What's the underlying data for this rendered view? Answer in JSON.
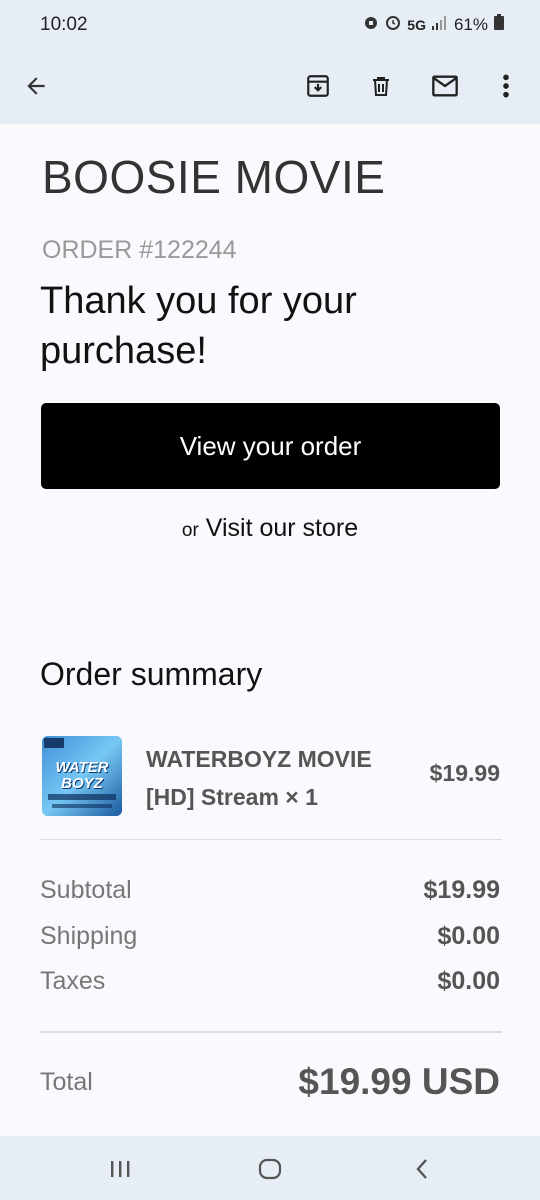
{
  "status_bar": {
    "time": "10:02",
    "network": "5G",
    "battery": "61%"
  },
  "app_bar": {
    "icons": [
      "back-arrow-icon",
      "archive-icon",
      "delete-icon",
      "mail-icon",
      "more-vert-icon"
    ]
  },
  "email": {
    "brand": "BOOSIE MOVIE",
    "order_number": "ORDER #122244",
    "thank_you": "Thank you for your purchase!",
    "view_order_button": "View your order",
    "or_text": "or",
    "visit_store_link": "Visit our store"
  },
  "order_summary": {
    "title": "Order summary",
    "item": {
      "name": "WATERBOYZ MOVIE [HD] Stream × 1",
      "price": "$19.99",
      "thumb_title": "WATER BOYZ"
    },
    "subtotal_label": "Subtotal",
    "subtotal_value": "$19.99",
    "shipping_label": "Shipping",
    "shipping_value": "$0.00",
    "taxes_label": "Taxes",
    "taxes_value": "$0.00",
    "total_label": "Total",
    "total_value": "$19.99 USD"
  },
  "nav_bar": {
    "icons": [
      "recents-icon",
      "home-icon",
      "back-icon"
    ]
  },
  "colors": {
    "chrome_background": "#e6edf5",
    "page_background": "#f9fafd",
    "button_background": "#000000"
  }
}
